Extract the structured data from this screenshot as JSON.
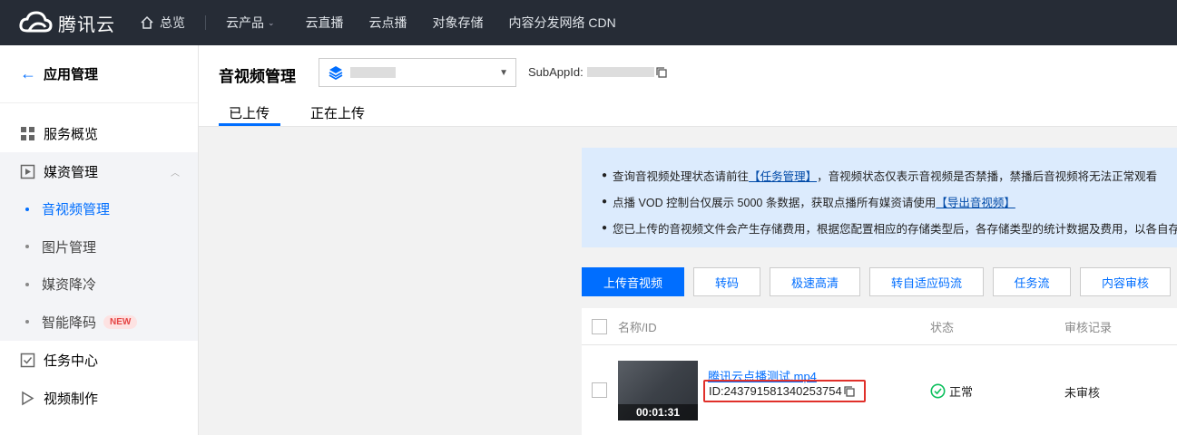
{
  "topbar": {
    "brand": "腾讯云",
    "overview": "总览",
    "products": "云产品",
    "links": [
      "云直播",
      "云点播",
      "对象存储",
      "内容分发网络 CDN"
    ]
  },
  "sidebar": {
    "back_label": "应用管理",
    "items": [
      {
        "label": "服务概览",
        "icon": "grid-icon"
      },
      {
        "label": "媒资管理",
        "icon": "media-icon"
      },
      {
        "label": "任务中心",
        "icon": "task-icon"
      },
      {
        "label": "视频制作",
        "icon": "play-icon"
      }
    ],
    "sub_items": [
      "音视频管理",
      "图片管理",
      "媒资降冷",
      "智能降码"
    ],
    "new_badge": "NEW"
  },
  "header": {
    "title": "音视频管理",
    "subappid_label": "SubAppId:",
    "tabs": [
      "已上传",
      "正在上传"
    ]
  },
  "banner": {
    "line1_pre": "查询音视频处理状态请前往",
    "line1_link": "【任务管理】",
    "line1_post": "，音视频状态仅表示音视频是否禁播，禁播后音视频将无法正常观看",
    "line2_pre": "点播 VOD 控制台仅展示 5000 条数据，获取点播所有媒资请使用",
    "line2_link": "【导出音视频】",
    "line3": "您已上传的音视频文件会产生存储费用，根据您配置相应的存储类型后，各存储类型的统计数据及费用，以各自存储类型为准"
  },
  "toolbar": {
    "upload": "上传音视频",
    "transcode": "转码",
    "tesHD": "极速高清",
    "adaptive": "转自适应码流",
    "workflow": "任务流",
    "review": "内容审核"
  },
  "table": {
    "headers": {
      "name": "名称/ID",
      "status": "状态",
      "review": "审核记录"
    },
    "row": {
      "name": "腾讯云点播测试.mp4",
      "id": "ID:243791581340253754",
      "duration": "00:01:31",
      "status": "正常",
      "review": "未审核"
    }
  },
  "colors": {
    "accent": "#006eff",
    "topbar": "#262c36",
    "highlight": "#e0302a",
    "success": "#0abf5b"
  }
}
